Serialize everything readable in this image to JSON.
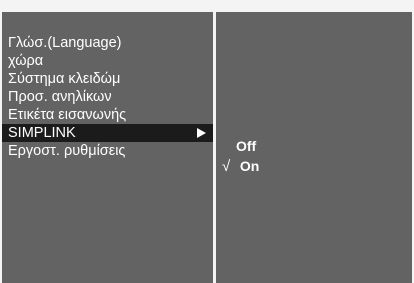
{
  "menu": {
    "items": [
      {
        "label": "Γλώσ.(Language)"
      },
      {
        "label": "χώρα"
      },
      {
        "label": "Σύστημα κλειδώμ"
      },
      {
        "label": "Προσ. ανηλίκων"
      },
      {
        "label": "Ετικέτα εισανωνής"
      },
      {
        "label": "SIMPLINK",
        "selected": true,
        "submenu_arrow": "right-arrow-icon"
      },
      {
        "label": "Εργοστ. ρυθμίσεις"
      }
    ]
  },
  "submenu": {
    "options": [
      {
        "label": "Off",
        "checked": false
      },
      {
        "label": "On",
        "checked": true,
        "check_symbol": "√"
      }
    ]
  },
  "colors": {
    "panel_bg": "#636363",
    "selected_bg": "#1b1b1b",
    "divider": "#f4f4f4",
    "text": "#ffffff"
  }
}
